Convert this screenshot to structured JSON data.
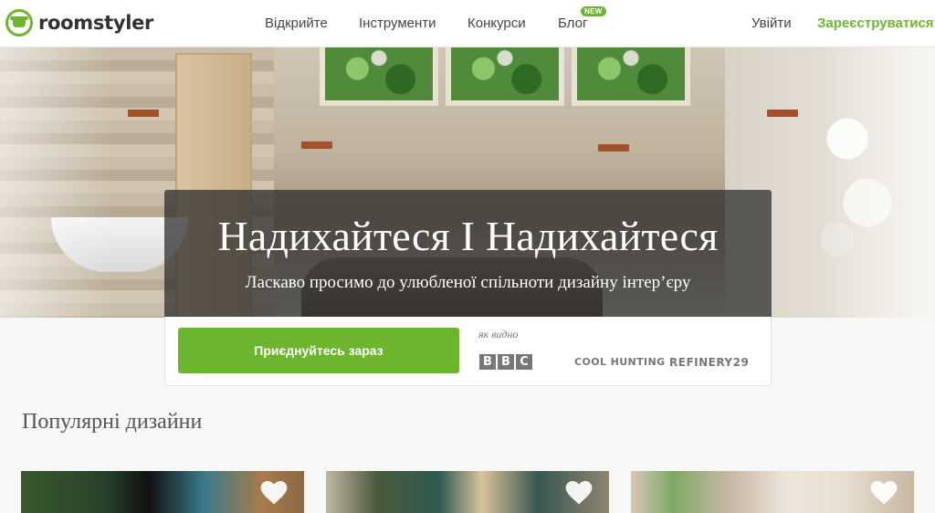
{
  "brand": {
    "name": "roomstyler"
  },
  "nav": {
    "links": [
      "Відкрийте",
      "Інструменти",
      "Конкурси",
      "Блог"
    ],
    "new_badge": "NEW",
    "login": "Увійти",
    "signup": "Зареєструватися"
  },
  "hero": {
    "title": "Надихайтеся І Надихайтеся",
    "subtitle": "Ласкаво просимо до улюбленої спільноти дизайну інтер’єру"
  },
  "join": {
    "button": "Приєднуйтесь зараз",
    "seen_label": "як видно",
    "press": [
      "BBC",
      "COOL HUNTING",
      "REFINERY29"
    ]
  },
  "popular": {
    "title": "Популярні дизайни"
  },
  "colors": {
    "accent": "#6eb52f",
    "text": "#444444"
  }
}
